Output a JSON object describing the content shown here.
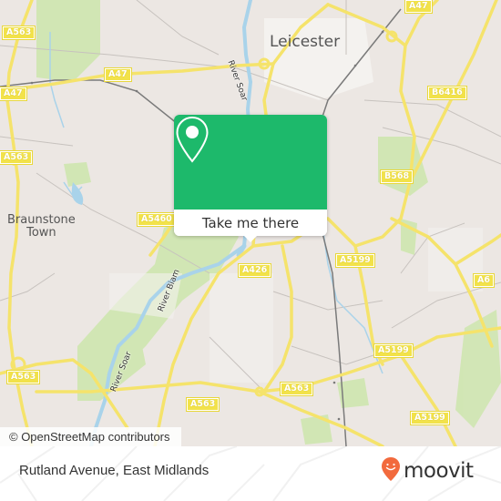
{
  "map": {
    "city_label": "Leicester",
    "places": [
      {
        "name": "Braunstone Town",
        "lines": [
          "Braunstone",
          "Town"
        ]
      }
    ],
    "rivers": [
      {
        "name": "River Soar",
        "instance": "north"
      },
      {
        "name": "River Biam",
        "instance": "middle"
      },
      {
        "name": "River Soar",
        "instance": "south"
      }
    ],
    "road_labels": [
      {
        "id": "a47-north",
        "text": "A47"
      },
      {
        "id": "a563-nw",
        "text": "A563"
      },
      {
        "id": "a47-west-1",
        "text": "A47"
      },
      {
        "id": "a47-west-2",
        "text": "A47"
      },
      {
        "id": "b6416",
        "text": "B6416"
      },
      {
        "id": "a563-west",
        "text": "A563"
      },
      {
        "id": "b568",
        "text": "B568"
      },
      {
        "id": "a5460",
        "text": "A5460"
      },
      {
        "id": "a426",
        "text": "A426"
      },
      {
        "id": "a5199-1",
        "text": "A5199"
      },
      {
        "id": "a6",
        "text": "A6"
      },
      {
        "id": "a563-sw",
        "text": "A563"
      },
      {
        "id": "a5199-2",
        "text": "A5199"
      },
      {
        "id": "a563-s1",
        "text": "A563"
      },
      {
        "id": "a563-s2",
        "text": "A563"
      },
      {
        "id": "a5199-3",
        "text": "A5199"
      }
    ],
    "attribution": "© OpenStreetMap contributors"
  },
  "popup": {
    "icon": "map-pin-icon",
    "button_label": "Take me there",
    "accent_color": "#1db96b"
  },
  "footer": {
    "location_name": "Rutland Avenue, East Midlands",
    "brand_name": "moovit",
    "brand_color": "#f26a3d"
  }
}
